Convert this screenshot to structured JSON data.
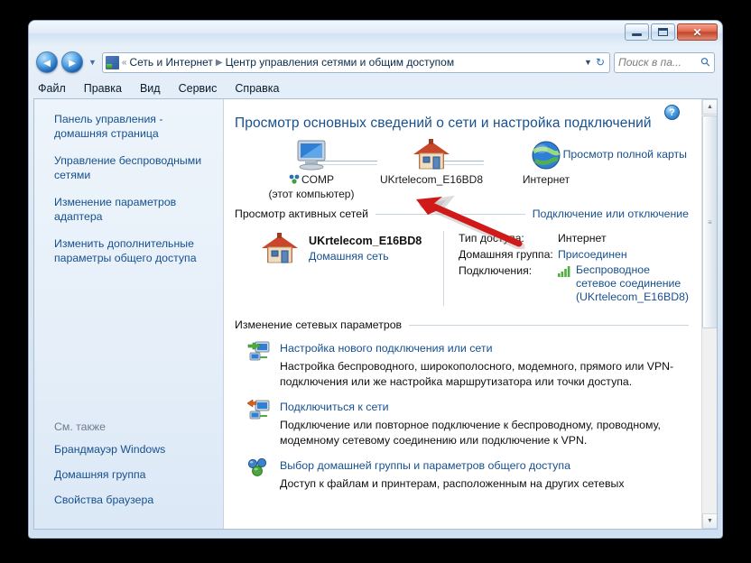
{
  "window": {
    "buttons": {
      "minimize": "minimize-button",
      "maximize": "maximize-button",
      "close_label": "✕"
    }
  },
  "nav": {
    "back": "◄",
    "forward": "►",
    "history_caret": "▼",
    "breadcrumb_prefix": "«",
    "crumbs": [
      {
        "label": "Сеть и Интернет",
        "sep": "▶"
      },
      {
        "label": "Центр управления сетями и общим доступом",
        "sep": ""
      }
    ],
    "address_caret": "▼",
    "refresh": "↻",
    "search": {
      "placeholder": "Поиск в па...",
      "icon": "search-icon"
    }
  },
  "menubar": {
    "items": [
      {
        "label": "Файл"
      },
      {
        "label": "Правка"
      },
      {
        "label": "Вид"
      },
      {
        "label": "Сервис"
      },
      {
        "label": "Справка"
      }
    ]
  },
  "sidebar": {
    "items": [
      {
        "label": "Панель управления - домашняя страница"
      },
      {
        "label": "Управление беспроводными сетями"
      },
      {
        "label": "Изменение параметров адаптера"
      },
      {
        "label": "Изменить дополнительные параметры общего доступа"
      }
    ],
    "see_also": {
      "heading": "См. также",
      "items": [
        {
          "label": "Брандмауэр Windows"
        },
        {
          "label": "Домашняя группа"
        },
        {
          "label": "Свойства браузера"
        }
      ]
    }
  },
  "main": {
    "help_label": "?",
    "page_title": "Просмотр основных сведений о сети и настройка подключений",
    "network_map": {
      "full_map_link": "Просмотр полной карты",
      "nodes": [
        {
          "label": "COMP",
          "sublabel": "(этот компьютер)",
          "icon": "computer-icon"
        },
        {
          "label": "UKrtelecom_E16BD8",
          "sublabel": "",
          "icon": "house-icon"
        },
        {
          "label": "Интернет",
          "sublabel": "",
          "icon": "globe-icon"
        }
      ]
    },
    "active_networks": {
      "heading": "Просмотр активных сетей",
      "action": "Подключение или отключение",
      "network": {
        "name": "UKrtelecom_E16BD8",
        "type": "Домашняя сеть",
        "icon": "house-icon"
      },
      "details": [
        {
          "key": "Тип доступа:",
          "value": "Интернет",
          "is_link": false
        },
        {
          "key": "Домашняя группа:",
          "value": "Присоединен",
          "is_link": true
        },
        {
          "key": "Подключения:",
          "value": "Беспроводное сетевое соединение (UKrtelecom_E16BD8)",
          "is_link": true,
          "icon": "wifi-signal-icon"
        }
      ]
    },
    "change_settings": {
      "heading": "Изменение сетевых параметров",
      "items": [
        {
          "icon": "new-connection-icon",
          "title": "Настройка нового подключения или сети",
          "description": "Настройка беспроводного, широкополосного, модемного, прямого или VPN-подключения или же настройка маршрутизатора или точки доступа."
        },
        {
          "icon": "connect-network-icon",
          "title": "Подключиться к сети",
          "description": "Подключение или повторное подключение к беспроводному, проводному, модемному сетевому соединению или подключение к VPN."
        },
        {
          "icon": "homegroup-icon",
          "title": "Выбор домашней группы и параметров общего доступа",
          "description": "Доступ к файлам и принтерам, расположенным на других сетевых"
        }
      ]
    }
  },
  "scrollbar": {
    "up": "▲",
    "down": "▼",
    "grip": "≡"
  },
  "annotation": {
    "arrow": "red-arrow-pointer"
  },
  "colors": {
    "link": "#17508f",
    "accent": "#1b63ae",
    "annotation": "#d01a1a"
  }
}
